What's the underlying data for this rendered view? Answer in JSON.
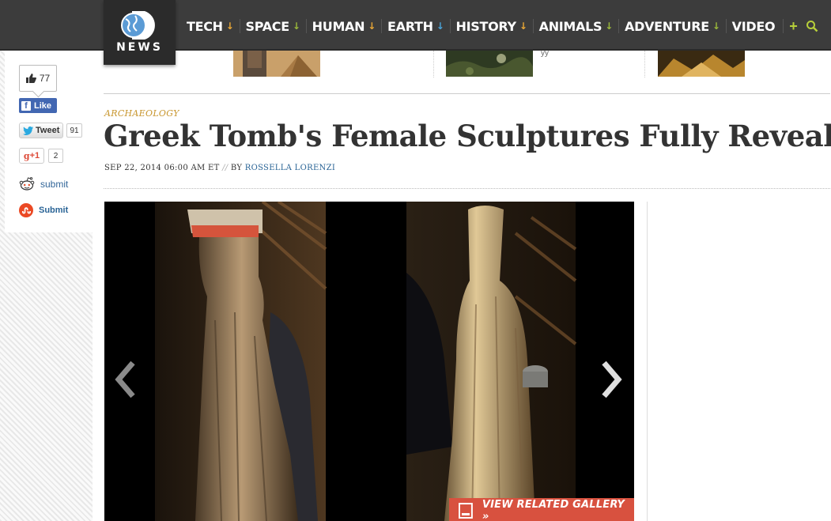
{
  "header": {
    "logo_text": "NEWS",
    "nav": [
      {
        "label": "TECH",
        "arrow": "↓",
        "arrow_color": "#e8a635"
      },
      {
        "label": "SPACE",
        "arrow": "↓",
        "arrow_color": "#9ab83b"
      },
      {
        "label": "HUMAN",
        "arrow": "↓",
        "arrow_color": "#e8a635"
      },
      {
        "label": "EARTH",
        "arrow": "↓",
        "arrow_color": "#4aa3d8"
      },
      {
        "label": "HISTORY",
        "arrow": "↓",
        "arrow_color": "#e8a635"
      },
      {
        "label": "ANIMALS",
        "arrow": "↓",
        "arrow_color": "#9ab83b"
      },
      {
        "label": "ADVENTURE",
        "arrow": "↓",
        "arrow_color": "#9ab83b"
      },
      {
        "label": "VIDEO",
        "arrow": "",
        "arrow_color": ""
      }
    ],
    "plus": "+",
    "search_icon": "search-icon"
  },
  "share": {
    "like_count": "77",
    "fb_label": "Like",
    "tweet_label": "Tweet",
    "tweet_count": "91",
    "gplus_label": "+1",
    "gplus_count": "2",
    "reddit_label": "submit",
    "stumble_label": "Submit"
  },
  "related": {
    "fragment_text": "yy"
  },
  "article": {
    "category": "ARCHAEOLOGY",
    "title": "Greek Tomb's Female Sculptures Fully Revealed",
    "date": "SEP 22, 2014 06:00 AM ET",
    "separator": "//",
    "by": "BY",
    "author": "ROSSELLA LORENZI"
  },
  "gallery": {
    "cta": "VIEW RELATED GALLERY »"
  },
  "colors": {
    "header_bg": "#3c3c3c",
    "category": "#c8962e",
    "link": "#2a6496",
    "cta_bg": "#d8513f"
  }
}
